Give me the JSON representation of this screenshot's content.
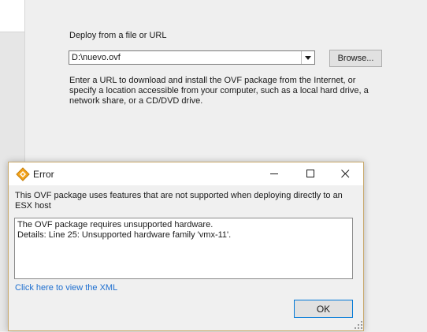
{
  "wizard": {
    "deploy_label": "Deploy from a file or URL",
    "source_value": "D:\\nuevo.ovf",
    "browse_label": "Browse...",
    "help_line1": "Enter a URL to download and install the OVF package from the Internet, or",
    "help_line2": "specify a location accessible from your computer, such as a local hard drive, a",
    "help_line3": "network share, or a CD/DVD drive."
  },
  "dialog": {
    "title": "Error",
    "message_line1": "This OVF package uses features that are not supported when deploying directly to an",
    "message_line2": "ESX host",
    "details": [
      "The OVF package requires unsupported hardware.",
      "Details: Line 25: Unsupported hardware family 'vmx-11'."
    ],
    "xml_link": "Click here to view the XML",
    "ok_label": "OK"
  },
  "icons": {
    "app": "vsphere-logo-icon",
    "minimize": "minimize-icon",
    "maximize": "maximize-icon",
    "close": "close-icon",
    "dropdown": "chevron-down-icon",
    "grip": "resize-grip-icon"
  },
  "colors": {
    "link": "#1e6fd0",
    "app_icon": "#f4a31a",
    "focus_border": "#0078d7"
  }
}
